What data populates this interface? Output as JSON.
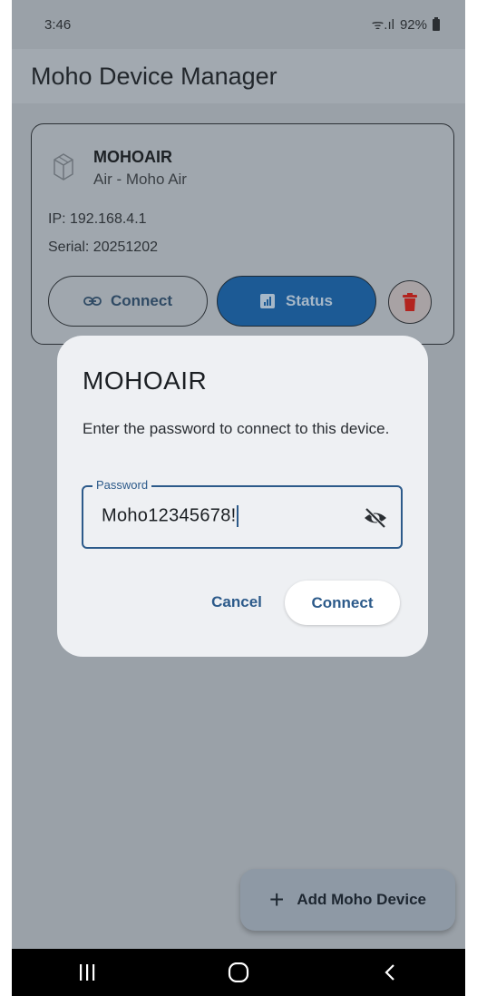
{
  "status_bar": {
    "time": "3:46",
    "signal_text": "ᯤ.ıl",
    "battery_text": "92%"
  },
  "app_bar": {
    "title": "Moho Device Manager"
  },
  "device_card": {
    "name": "MOHOAIR",
    "subtitle": "Air - Moho Air",
    "ip": "IP: 192.168.4.1",
    "serial": "Serial: 20251202",
    "connect_label": "Connect",
    "status_label": "Status",
    "icons": {
      "device": "device-box-icon",
      "link": "link-icon",
      "status": "signal-chart-icon",
      "delete": "trash-icon"
    }
  },
  "dialog": {
    "title": "MOHOAIR",
    "message": "Enter the password to connect to this device.",
    "password_label": "Password",
    "password_value": "Moho12345678!",
    "cancel_label": "Cancel",
    "connect_label": "Connect",
    "icons": {
      "visibility": "eye-off-icon"
    }
  },
  "fab": {
    "label": "Add Moho Device",
    "icon": "plus-icon"
  },
  "nav_bar": {
    "icons": [
      "recent-apps-icon",
      "home-icon",
      "back-icon"
    ]
  },
  "colors": {
    "accent": "#2c5a8a",
    "status_button": "#1c5a95",
    "delete": "#c62828",
    "scrim_background": "#9aa1a8",
    "dialog_background": "#eef0f3"
  }
}
